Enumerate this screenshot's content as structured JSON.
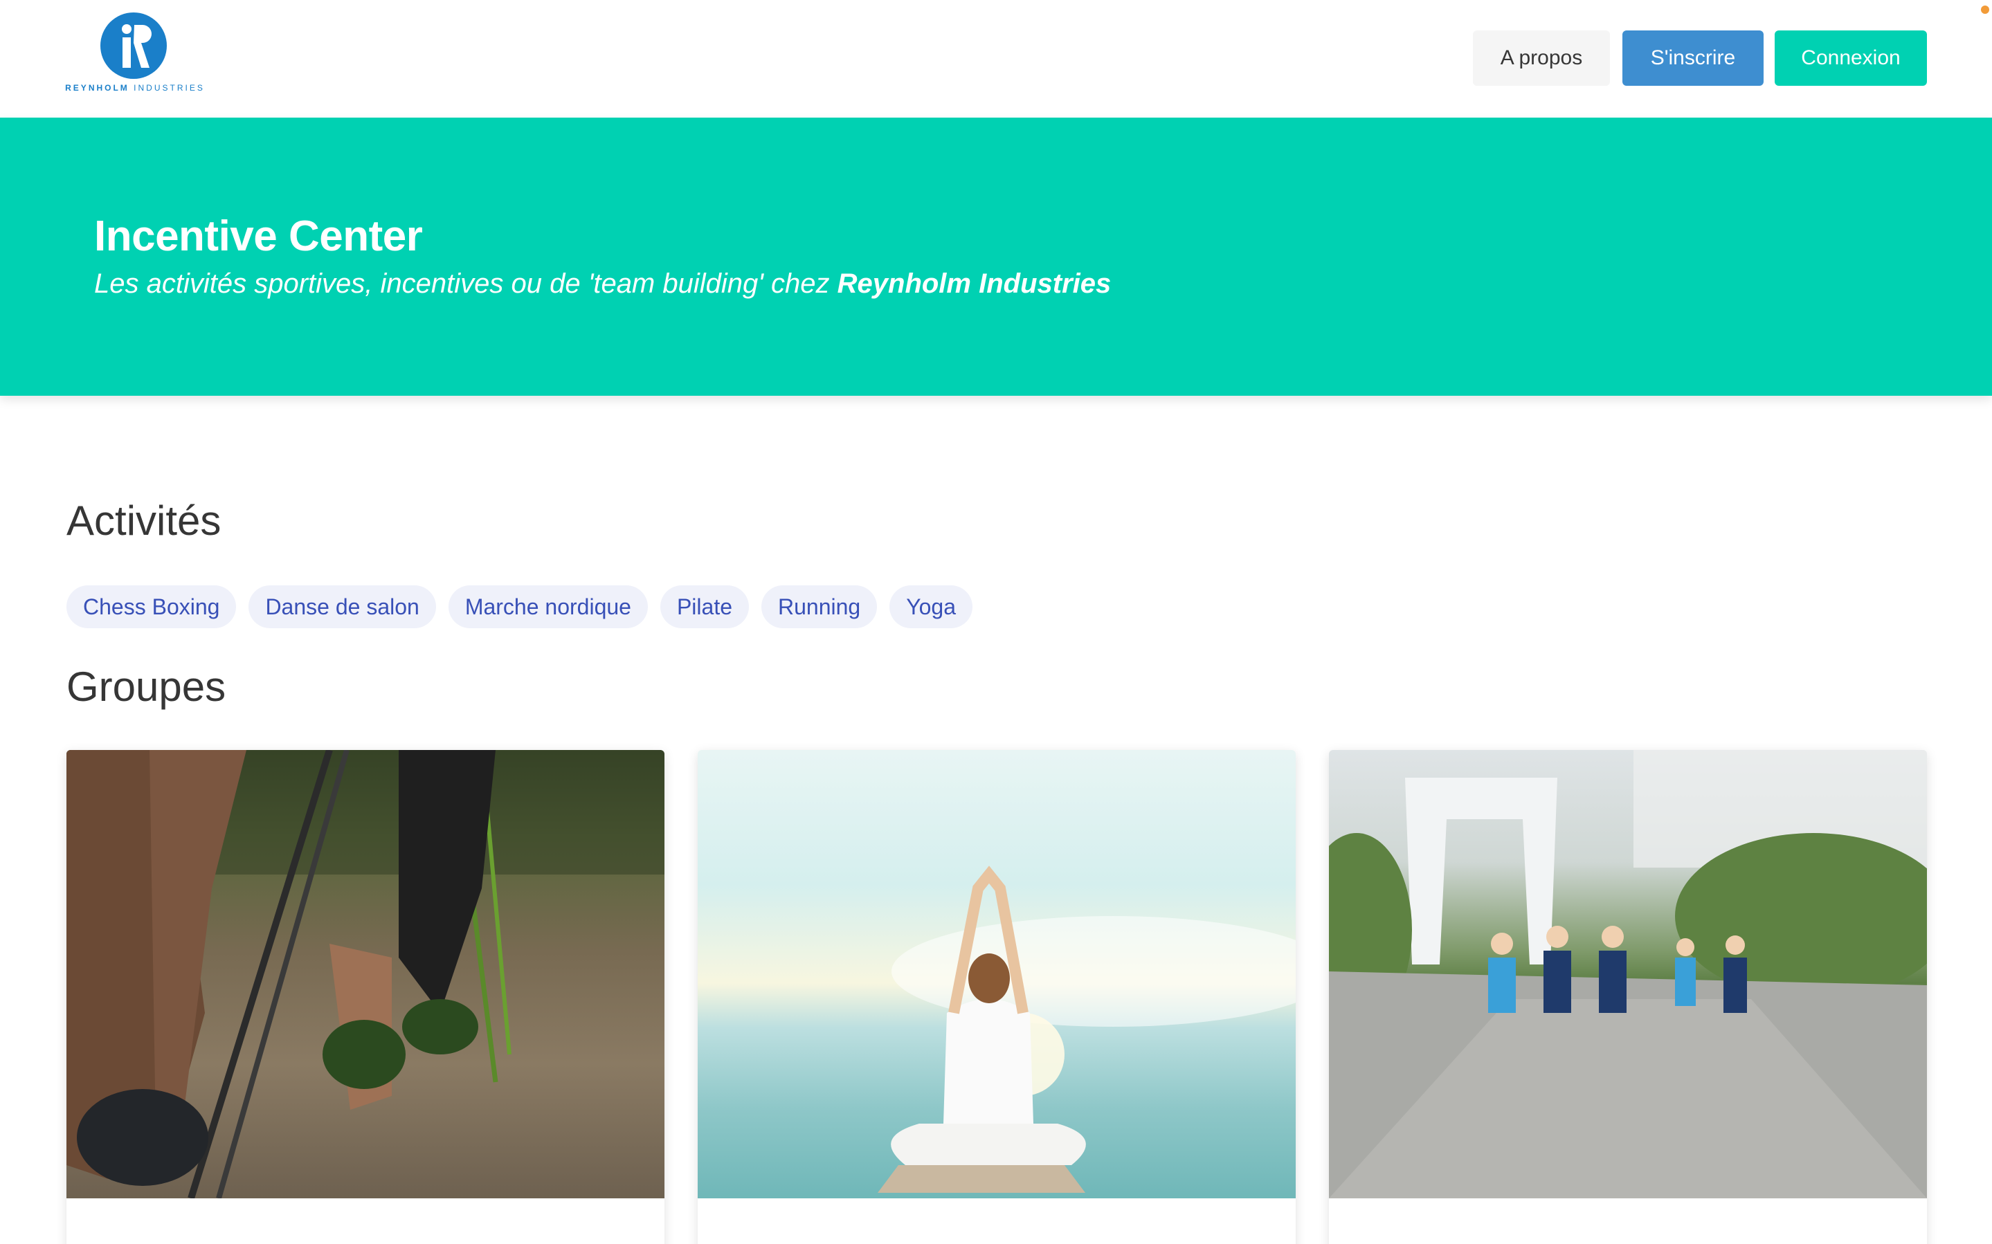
{
  "header": {
    "logo": {
      "brand": "REYNHOLM",
      "brand_suffix": "INDUSTRIES"
    },
    "nav": {
      "about_label": "A propos",
      "signup_label": "S'inscrire",
      "login_label": "Connexion"
    }
  },
  "hero": {
    "title": "Incentive Center",
    "subtitle_prefix": "Les activités sportives, incentives ou de 'team building' chez ",
    "subtitle_company": "Reynholm Industries"
  },
  "activities": {
    "title": "Activités",
    "tags": [
      "Chess Boxing",
      "Danse de salon",
      "Marche nordique",
      "Pilate",
      "Running",
      "Yoga"
    ]
  },
  "groups": {
    "title": "Groupes",
    "cards": [
      {
        "image": "nordic-walking-photo"
      },
      {
        "image": "yoga-meditation-photo"
      },
      {
        "image": "city-running-photo"
      }
    ]
  },
  "colors": {
    "primary": "#00d1b2",
    "link": "#3e8ed0",
    "tag_bg": "#eff1fa",
    "tag_text": "#3850b7"
  }
}
